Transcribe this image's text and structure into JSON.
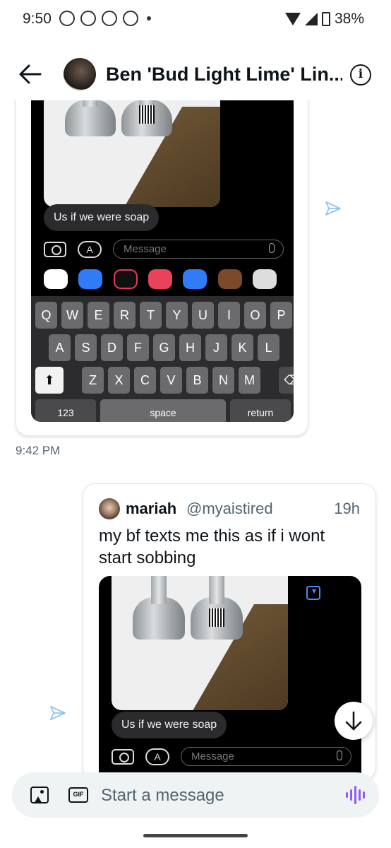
{
  "status_bar": {
    "time": "9:50",
    "battery": "38%"
  },
  "header": {
    "title": "Ben 'Bud Light Lime' Lin...",
    "info_glyph": "i"
  },
  "card1": {
    "bubble_text": "Us if we were soap",
    "message_placeholder": "Message",
    "keyboard": {
      "row1": [
        "Q",
        "W",
        "E",
        "R",
        "T",
        "Y",
        "U",
        "I",
        "O",
        "P"
      ],
      "row2": [
        "A",
        "S",
        "D",
        "F",
        "G",
        "H",
        "J",
        "K",
        "L"
      ],
      "row3": [
        "Z",
        "X",
        "C",
        "V",
        "B",
        "N",
        "M"
      ],
      "numbers_key": "123",
      "space_key": "space",
      "return_key": "return"
    }
  },
  "timestamp": "9:42 PM",
  "card2": {
    "author_name": "mariah",
    "author_handle": "@myaistired",
    "time_ago": "19h",
    "text": "my bf texts me this as if i wont start sobbing",
    "bubble_text": "Us if we were soap",
    "message_placeholder": "Message"
  },
  "composer": {
    "placeholder": "Start a message",
    "gif_label": "GIF"
  },
  "colors": {
    "accent": "#1d9bf0",
    "voice": "#8f5cf7",
    "secondary_text": "#536471"
  },
  "icons": [
    "back-arrow-icon",
    "info-icon",
    "send-icon",
    "camera-icon",
    "app-store-icon",
    "mic-icon",
    "download-icon",
    "scroll-down-arrow-icon",
    "image-icon",
    "gif-icon",
    "voice-wave-icon"
  ]
}
